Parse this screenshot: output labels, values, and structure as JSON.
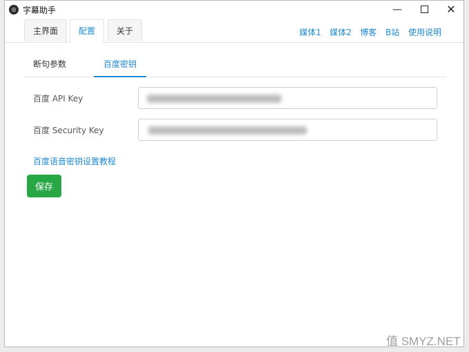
{
  "window": {
    "title": "字幕助手",
    "minimize": "—",
    "close": "✕"
  },
  "tabs": [
    {
      "label": "主界面"
    },
    {
      "label": "配置"
    },
    {
      "label": "关于"
    }
  ],
  "top_links": [
    "媒体1",
    "媒体2",
    "博客",
    "B站",
    "使用说明"
  ],
  "sub_tabs": [
    {
      "label": "断句参数"
    },
    {
      "label": "百度密钥"
    }
  ],
  "fields": {
    "api_key": {
      "label": "百度 API Key",
      "value": ""
    },
    "security_key": {
      "label": "百度 Security Key",
      "value": ""
    }
  },
  "tutorial_link": "百度语音密钥设置教程",
  "save_label": "保存",
  "watermark": "值 SMYZ.NET",
  "colors": {
    "accent": "#1f8ad0",
    "save": "#28a745"
  }
}
